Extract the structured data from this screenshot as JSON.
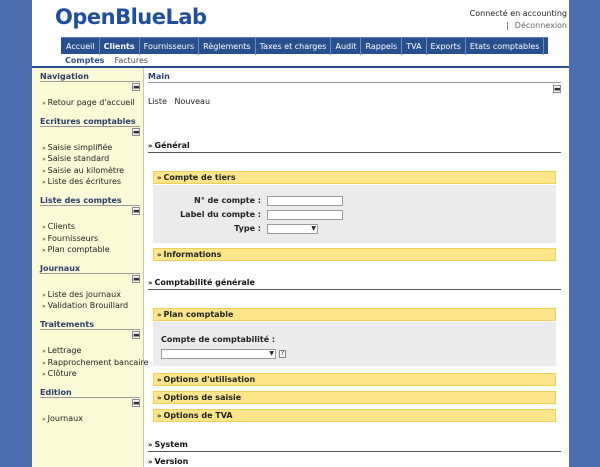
{
  "header": {
    "logo": "OpenBlueLab",
    "user_status": "Connecté en accounting",
    "separator": "|",
    "logout": "Déconnexion"
  },
  "mainnav": [
    "Accueil",
    "Clients",
    "Fournisseurs",
    "Règlements",
    "Taxes et charges",
    "Audit",
    "Rappels",
    "TVA",
    "Exports",
    "Etats comptables"
  ],
  "mainnav_active": "Clients",
  "subnav": [
    "Comptes",
    "Factures"
  ],
  "subnav_active": "Comptes",
  "sidebar": [
    {
      "title": "Navigation",
      "items": [
        "Retour page d'accueil"
      ]
    },
    {
      "title": "Ecritures comptables",
      "items": [
        "Saisie simplifiée",
        "Saisie standard",
        "Saisie au kilomètre",
        "Liste des écritures"
      ]
    },
    {
      "title": "Liste des comptes",
      "items": [
        "Clients",
        "Fournisseurs",
        "Plan comptable"
      ]
    },
    {
      "title": "Journaux",
      "items": [
        "Liste des journaux",
        "Validation Brouillard"
      ]
    },
    {
      "title": "Traitements",
      "items": [
        "Lettrage",
        "Rapprochement bancaire",
        "Clôture"
      ]
    },
    {
      "title": "Edition",
      "items": [
        "Journaux"
      ]
    }
  ],
  "main": {
    "title": "Main",
    "actions": [
      "Liste",
      "Nouveau"
    ],
    "toggle_symbol": "▬",
    "sections": {
      "general": "Général",
      "compte_tiers": "Compte de tiers",
      "informations": "Informations",
      "comptabilite_generale": "Comptabilité générale",
      "plan_comptable": "Plan comptable",
      "options_utilisation": "Options d'utilisation",
      "options_saisie": "Options de saisie",
      "options_tva": "Options de TVA",
      "system": "System",
      "version": "Version"
    },
    "fields": {
      "numero_compte": "N° de compte :",
      "label_compte": "Label du compte :",
      "type": "Type :",
      "compte_comptabilite": "Compte de comptabilité :"
    }
  },
  "colors": {
    "nav_blue": "#2a4f8f",
    "background": "#4a6eb0",
    "sidebar_bg": "#fbfad6",
    "section_yellow": "#fde68a"
  }
}
